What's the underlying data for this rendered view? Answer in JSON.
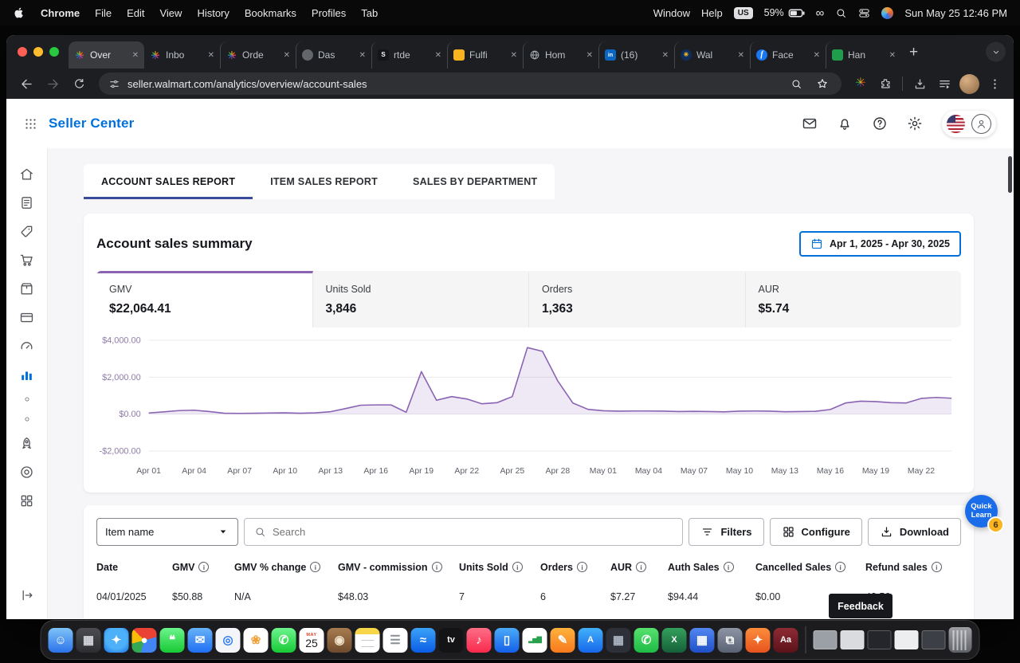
{
  "menu_bar": {
    "items": [
      "Chrome",
      "File",
      "Edit",
      "View",
      "History",
      "Bookmarks",
      "Profiles",
      "Tab"
    ],
    "right_items": [
      "Window",
      "Help"
    ],
    "input_source": "US",
    "battery": "59%",
    "clock": "Sun May 25 12:46 PM"
  },
  "browser": {
    "url": "seller.walmart.com/analytics/overview/account-sales",
    "tabs": [
      {
        "label": "Over",
        "favicon": "spark-icon"
      },
      {
        "label": "Inbo",
        "favicon": "spark-icon"
      },
      {
        "label": "Orde",
        "favicon": "spark-icon"
      },
      {
        "label": "Das",
        "favicon": "dark-circle-icon"
      },
      {
        "label": "rtde",
        "favicon": "s-logo-icon"
      },
      {
        "label": "Fulfi",
        "favicon": "yellow-icon"
      },
      {
        "label": "Hom",
        "favicon": "globe-icon"
      },
      {
        "label": "(16)",
        "favicon": "linkedin-icon"
      },
      {
        "label": "Wal",
        "favicon": "navy-spark-icon"
      },
      {
        "label": "Face",
        "favicon": "facebook-icon"
      },
      {
        "label": "Han",
        "favicon": "green-icon"
      }
    ]
  },
  "app": {
    "brand": "Seller Center",
    "report_tabs": [
      {
        "label": "ACCOUNT SALES REPORT",
        "active": true
      },
      {
        "label": "ITEM SALES REPORT",
        "active": false
      },
      {
        "label": "SALES BY DEPARTMENT",
        "active": false
      }
    ],
    "sidebar": {
      "items": [
        {
          "icon": "home",
          "active": false
        },
        {
          "icon": "documents",
          "active": false
        },
        {
          "icon": "tag",
          "active": false
        },
        {
          "icon": "cart",
          "active": false
        },
        {
          "icon": "box",
          "active": false
        },
        {
          "icon": "payments",
          "active": false
        },
        {
          "icon": "gauge",
          "active": false
        },
        {
          "icon": "analytics",
          "active": true
        },
        {
          "icon": "dot",
          "active": false
        },
        {
          "icon": "dot",
          "active": false
        },
        {
          "icon": "rocket",
          "active": false
        },
        {
          "icon": "target",
          "active": false
        },
        {
          "icon": "apps",
          "active": false
        }
      ],
      "bottom": {
        "icon": "collapse"
      }
    },
    "summary": {
      "title": "Account sales summary",
      "date_range": "Apr 1, 2025 - Apr 30, 2025",
      "stats": [
        {
          "label": "GMV",
          "value": "$22,064.41",
          "selected": true
        },
        {
          "label": "Units Sold",
          "value": "3,846",
          "selected": false
        },
        {
          "label": "Orders",
          "value": "1,363",
          "selected": false
        },
        {
          "label": "AUR",
          "value": "$5.74",
          "selected": false
        }
      ]
    },
    "table": {
      "item_selector": "Item name",
      "search_placeholder": "Search",
      "buttons": [
        "Filters",
        "Configure",
        "Download"
      ],
      "columns": [
        {
          "label": "Date",
          "info": false
        },
        {
          "label": "GMV",
          "info": true
        },
        {
          "label": "GMV % change",
          "info": true
        },
        {
          "label": "GMV - commission",
          "info": true
        },
        {
          "label": "Units Sold",
          "info": true
        },
        {
          "label": "Orders",
          "info": true
        },
        {
          "label": "AUR",
          "info": true
        },
        {
          "label": "Auth Sales",
          "info": true
        },
        {
          "label": "Cancelled Sales",
          "info": true
        },
        {
          "label": "Refund sales",
          "info": true
        }
      ],
      "rows": [
        [
          "04/01/2025",
          "$50.88",
          "N/A",
          "$48.03",
          "7",
          "6",
          "$7.27",
          "$94.44",
          "$0.00",
          "43.56"
        ]
      ]
    },
    "feedback": "Feedback",
    "quick_learn": {
      "line1": "Quick",
      "line2": "Learn",
      "badge": "6"
    }
  },
  "chart_data": {
    "type": "area",
    "title": "Account sales summary - GMV daily trend",
    "xlabel": "",
    "ylabel": "",
    "ylim": [
      -2000,
      4000
    ],
    "grid": true,
    "line_color": "#8a63b3",
    "fill_color": "rgba(138,99,179,0.14)",
    "y_ticks": [
      {
        "value": 4000,
        "label": "$4,000.00"
      },
      {
        "value": 2000,
        "label": "$2,000.00"
      },
      {
        "value": 0,
        "label": "$0.00"
      },
      {
        "value": -2000,
        "label": "-$2,000.00"
      }
    ],
    "x_ticks": [
      {
        "index": 0,
        "label": "Apr 01"
      },
      {
        "index": 3,
        "label": "Apr 04"
      },
      {
        "index": 6,
        "label": "Apr 07"
      },
      {
        "index": 9,
        "label": "Apr 10"
      },
      {
        "index": 12,
        "label": "Apr 13"
      },
      {
        "index": 15,
        "label": "Apr 16"
      },
      {
        "index": 18,
        "label": "Apr 19"
      },
      {
        "index": 21,
        "label": "Apr 22"
      },
      {
        "index": 24,
        "label": "Apr 25"
      },
      {
        "index": 27,
        "label": "Apr 28"
      },
      {
        "index": 30,
        "label": "May 01"
      },
      {
        "index": 33,
        "label": "May 04"
      },
      {
        "index": 36,
        "label": "May 07"
      },
      {
        "index": 39,
        "label": "May 10"
      },
      {
        "index": 42,
        "label": "May 13"
      },
      {
        "index": 45,
        "label": "May 16"
      },
      {
        "index": 48,
        "label": "May 19"
      },
      {
        "index": 51,
        "label": "May 22"
      }
    ],
    "dates": [
      "Apr 01",
      "Apr 02",
      "Apr 03",
      "Apr 04",
      "Apr 05",
      "Apr 06",
      "Apr 07",
      "Apr 08",
      "Apr 09",
      "Apr 10",
      "Apr 11",
      "Apr 12",
      "Apr 13",
      "Apr 14",
      "Apr 15",
      "Apr 16",
      "Apr 17",
      "Apr 18",
      "Apr 19",
      "Apr 20",
      "Apr 21",
      "Apr 22",
      "Apr 23",
      "Apr 24",
      "Apr 25",
      "Apr 26",
      "Apr 27",
      "Apr 28",
      "Apr 29",
      "Apr 30",
      "May 01",
      "May 02",
      "May 03",
      "May 04",
      "May 05",
      "May 06",
      "May 07",
      "May 08",
      "May 09",
      "May 10",
      "May 11",
      "May 12",
      "May 13",
      "May 14",
      "May 15",
      "May 16",
      "May 17",
      "May 18",
      "May 19",
      "May 20",
      "May 21",
      "May 22",
      "May 23",
      "May 24"
    ],
    "series": [
      {
        "name": "GMV",
        "values": [
          60,
          120,
          190,
          210,
          140,
          50,
          40,
          50,
          60,
          70,
          50,
          70,
          130,
          300,
          480,
          500,
          500,
          100,
          2300,
          750,
          950,
          820,
          560,
          620,
          950,
          3600,
          3400,
          1800,
          600,
          260,
          180,
          160,
          170,
          170,
          160,
          140,
          150,
          140,
          120,
          160,
          170,
          160,
          130,
          140,
          150,
          250,
          600,
          700,
          680,
          620,
          600,
          850,
          900,
          860
        ]
      }
    ]
  },
  "colors": {
    "brand_blue": "#0071dc",
    "tab_underline": "#3a4b9e",
    "chart_purple": "#8a63b3",
    "quick_learn_blue": "#1b6ce8",
    "badge_orange": "#fbb422"
  },
  "dock": {
    "items": [
      {
        "name": "finder-icon",
        "bg": "linear-gradient(180deg,#7ec3f7,#2b72ea)",
        "glyph": "☺",
        "fg": "#ffffff"
      },
      {
        "name": "launchpad-icon",
        "bg": "linear-gradient(180deg,#4c4d52,#2c2d31)",
        "glyph": "▦",
        "fg": "#d6d9df"
      },
      {
        "name": "safari-icon",
        "bg": "radial-gradient(circle at 50% 42%,#4cb1f8 55%,#1a6de6)",
        "glyph": "✦",
        "fg": "#ffffff"
      },
      {
        "name": "chrome-icon",
        "bg": "conic-gradient(from -45deg,#ea4335 0 120deg,#4285f4 0 240deg,#34a853 0 300deg,#fbbc05 0 360deg)",
        "glyph": "●",
        "fg": "#ffffff"
      },
      {
        "name": "messages-icon",
        "bg": "linear-gradient(180deg,#6bf58c,#17c934)",
        "glyph": "❝",
        "fg": "#ffffff"
      },
      {
        "name": "mail-app-icon",
        "bg": "linear-gradient(180deg,#66b2f8,#1f6ef2)",
        "glyph": "✉",
        "fg": "#ffffff"
      },
      {
        "name": "find-my-icon",
        "bg": "#f3f5f8",
        "glyph": "◎",
        "fg": "#2f7cf6"
      },
      {
        "name": "photos-icon",
        "bg": "#ffffff",
        "glyph": "❀",
        "fg": "#f0a13a"
      },
      {
        "name": "facetime-icon",
        "bg": "linear-gradient(180deg,#6bf58c,#17c934)",
        "glyph": "✆",
        "fg": "#ffffff"
      },
      {
        "name": "calendar-app-icon",
        "kind": "calendar",
        "month": "MAY",
        "day": "25"
      },
      {
        "name": "photo-booth-icon",
        "bg": "linear-gradient(180deg,#a87c50,#6e4a2c)",
        "glyph": "◉",
        "fg": "#f2e3cb"
      },
      {
        "name": "notes-icon",
        "kind": "notes"
      },
      {
        "name": "reminders-icon",
        "bg": "#ffffff",
        "glyph": "☰",
        "fg": "#898f97"
      },
      {
        "name": "weather-icon",
        "bg": "linear-gradient(180deg,#3aa2f8,#0b5ce4)",
        "glyph": "≈",
        "fg": "#ffffff"
      },
      {
        "name": "apple-tv-icon",
        "bg": "#141416",
        "text": "tv",
        "fg": "#ffffff"
      },
      {
        "name": "music-icon",
        "bg": "linear-gradient(180deg,#fc6e85,#f9294d)",
        "glyph": "♪",
        "fg": "#ffffff"
      },
      {
        "name": "iphone-mirroring-icon",
        "bg": "linear-gradient(180deg,#4aa9f8,#155fe9)",
        "glyph": "▯",
        "fg": "#ffffff"
      },
      {
        "name": "stocks-icon",
        "bg": "#ffffff",
        "glyph": "▂▅▇",
        "fg": "#27a14b",
        "small": true
      },
      {
        "name": "pencil-app-icon",
        "bg": "linear-gradient(180deg,#ffb23d,#f7791d)",
        "glyph": "✎",
        "fg": "#ffffff"
      },
      {
        "name": "app-store-icon",
        "bg": "linear-gradient(180deg,#42b0f9,#1667ea)",
        "text": "A",
        "fg": "#ffffff"
      },
      {
        "name": "utilities-icon",
        "bg": "#2d3038",
        "glyph": "▦",
        "fg": "#aeb6c4"
      },
      {
        "name": "whatsapp-icon",
        "bg": "linear-gradient(180deg,#57e16e,#1dbb45)",
        "glyph": "✆",
        "fg": "#ffffff"
      },
      {
        "name": "excel-icon",
        "bg": "linear-gradient(180deg,#33a05c,#156038)",
        "text": "X",
        "fg": "#ffffff"
      },
      {
        "name": "microsoft-apps-icon",
        "bg": "linear-gradient(180deg,#5287f1,#2050c8)",
        "glyph": "▦",
        "fg": "#ffffff"
      },
      {
        "name": "displays-icon",
        "bg": "linear-gradient(180deg,#8d95a5,#596273)",
        "glyph": "⧉",
        "fg": "#ffffff"
      },
      {
        "name": "creative-app-icon",
        "bg": "linear-gradient(180deg,#fb8d3d,#e7531e)",
        "glyph": "✦",
        "fg": "#ffffff"
      },
      {
        "name": "font-book-icon",
        "bg": "linear-gradient(180deg,#8e2b34,#5c121a)",
        "text": "Aa",
        "fg": "#ffffff"
      },
      {
        "name": "dock-divider",
        "kind": "sep"
      },
      {
        "name": "minimized-window",
        "kind": "window",
        "bg": "#9aa0a6"
      },
      {
        "name": "minimized-window",
        "kind": "window",
        "bg": "#d9dbde"
      },
      {
        "name": "minimized-window",
        "kind": "window",
        "bg": "#24262b"
      },
      {
        "name": "minimized-window",
        "kind": "window",
        "bg": "#eceef0"
      },
      {
        "name": "minimized-window",
        "kind": "window",
        "bg": "#3c3f45"
      },
      {
        "name": "trash-icon",
        "kind": "trash"
      }
    ]
  }
}
